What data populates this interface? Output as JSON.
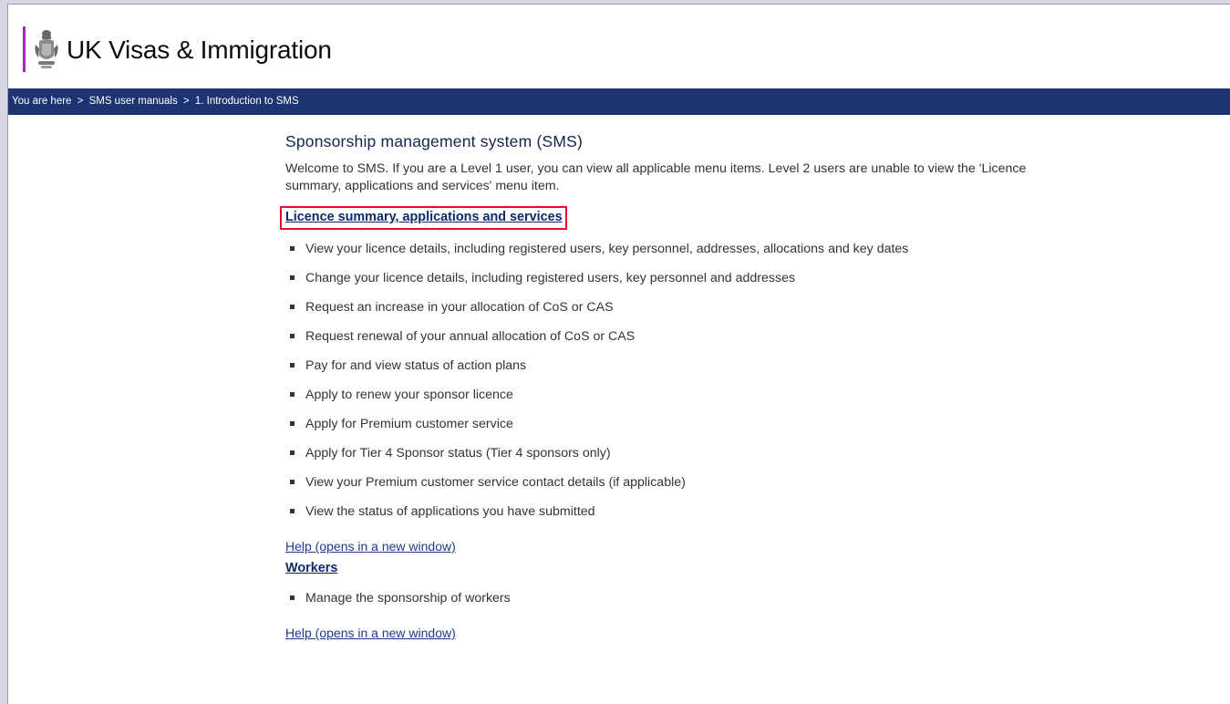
{
  "header": {
    "brand_name": "UK Visas & Immigration",
    "crest_icon": "royal-crest-icon",
    "accent_color": "#a62ab5"
  },
  "breadcrumb": {
    "prefix": "You are here",
    "separator": ">",
    "items": [
      "SMS user manuals",
      "1. Introduction to SMS"
    ],
    "bar_color": "#1d3472"
  },
  "main": {
    "title": "Sponsorship management system (SMS)",
    "intro": "Welcome to SMS. If you are a Level 1 user, you can view all applicable menu items. Level 2 users are unable to view the 'Licence summary, applications and services' menu item.",
    "sections": [
      {
        "link_label": "Licence summary, applications and services",
        "highlighted": true,
        "highlight_color": "#e0102a",
        "items": [
          "View your licence details, including registered users, key personnel, addresses, allocations and key dates",
          "Change your licence details, including registered users, key personnel and addresses",
          "Request an increase in your allocation of CoS or CAS",
          "Request renewal of your annual allocation of CoS or CAS",
          "Pay for and view status of action plans",
          "Apply to renew your sponsor licence",
          "Apply for Premium customer service",
          "Apply for Tier 4 Sponsor status (Tier 4 sponsors only)",
          "View your Premium customer service contact details (if applicable)",
          "View the status of applications you have submitted"
        ],
        "help_label": "Help (opens in a new window)"
      },
      {
        "link_label": "Workers",
        "highlighted": false,
        "items": [
          "Manage the sponsorship of workers"
        ],
        "help_label": "Help (opens in a new window)"
      }
    ]
  }
}
